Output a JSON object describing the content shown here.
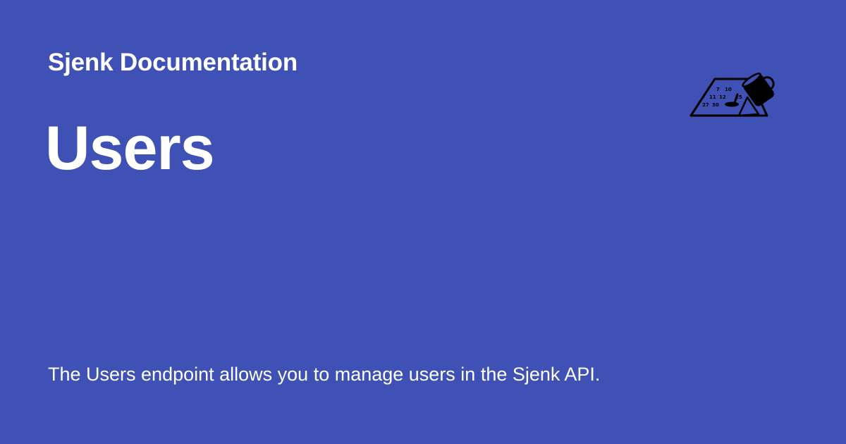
{
  "header": {
    "site_title": "Sjenk Documentation"
  },
  "page": {
    "title": "Users",
    "description": "The Users endpoint allows you to manage users in the Sjenk API."
  },
  "logo": {
    "icon": "calendar-pouring-cup-icon",
    "calendar_numbers": [
      "7",
      "10",
      "11",
      "12",
      "25",
      "27",
      "30"
    ]
  },
  "colors": {
    "background": "#3f51b5",
    "text": "#ffffff",
    "logo": "#000000"
  }
}
